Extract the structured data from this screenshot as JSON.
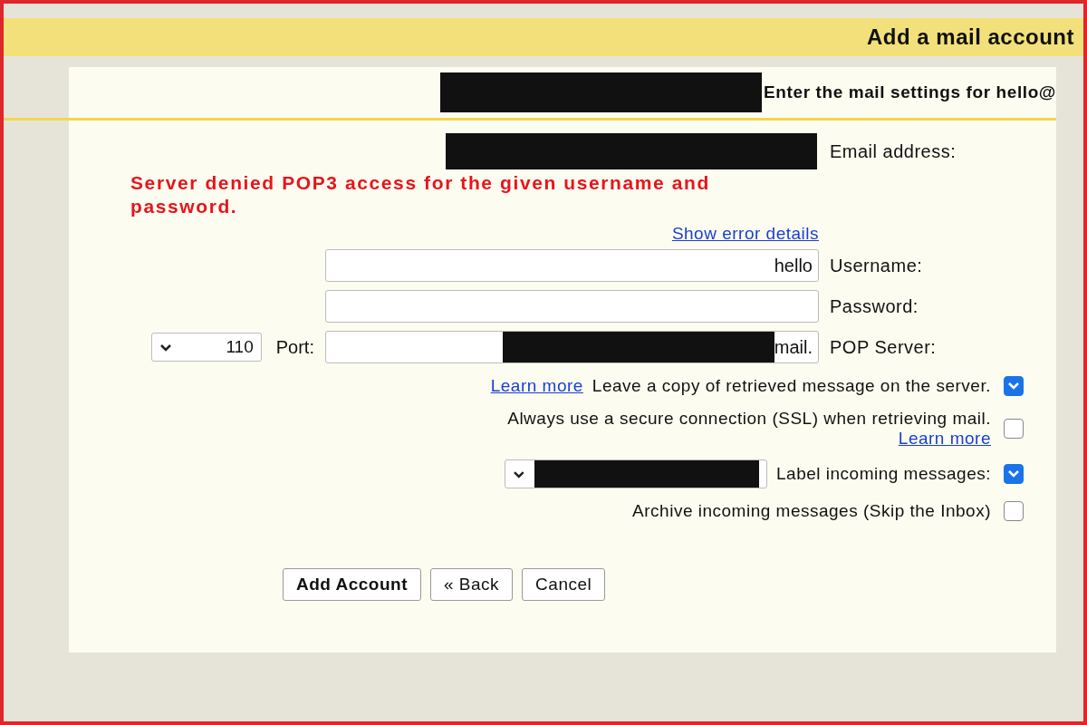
{
  "title": "Add a mail account",
  "subtitle": "Enter the mail settings for hello@",
  "email": {
    "label": "Email address:"
  },
  "error": "Server denied POP3 access for the given username and password.",
  "error_link": "Show error details",
  "fields": [
    {
      "label": "Username:",
      "value": "hello"
    },
    {
      "label": "Password:"
    }
  ],
  "pop_server": {
    "label": "POP Server:",
    "value": "mail.",
    "port_label": "Port:",
    "port": "110"
  },
  "options": [
    {
      "kind": "link_inline",
      "label": "Leave a copy of retrieved message on the server.",
      "link": "Learn more",
      "checked": true
    },
    {
      "kind": "link_below",
      "label": "Always use a secure connection (SSL) when retrieving mail.",
      "link": "Learn more",
      "checked": false
    },
    {
      "kind": "select",
      "label": "Label incoming messages:",
      "checked": true
    },
    {
      "kind": "plain",
      "label": "Archive incoming messages (Skip the Inbox)",
      "checked": false
    }
  ],
  "buttons": [
    {
      "label": "Add Account",
      "kind": "primary"
    },
    {
      "label": "« Back",
      "kind": "normal"
    },
    {
      "label": "Cancel",
      "kind": "normal"
    }
  ]
}
